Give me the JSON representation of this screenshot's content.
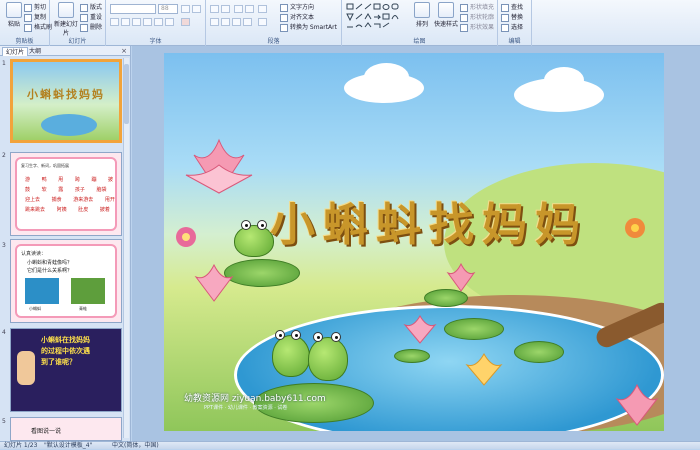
{
  "ribbon": {
    "groups": [
      {
        "title": "剪贴板",
        "buttons": [
          "粘贴",
          "剪切",
          "复制",
          "格式刷"
        ]
      },
      {
        "title": "幻灯片",
        "buttons": [
          "新建幻灯片",
          "版式",
          "重设",
          "删除"
        ]
      },
      {
        "title": "字体",
        "buttons": []
      },
      {
        "title": "段落",
        "buttons": [
          "文字方向",
          "对齐文本",
          "转换为 SmartArt"
        ]
      },
      {
        "title": "绘图",
        "buttons": [
          "排列",
          "快速样式",
          "形状填充",
          "形状轮廓",
          "形状效果"
        ]
      },
      {
        "title": "编辑",
        "buttons": [
          "查找",
          "替换",
          "选择"
        ]
      }
    ],
    "font_name": "",
    "font_size": "88"
  },
  "panel": {
    "tabs": [
      "幻灯片",
      "大纲"
    ],
    "slide_numbers": [
      "1",
      "2",
      "3",
      "4",
      "5"
    ],
    "thumb1_title": "小蝌蚪找妈妈",
    "thumb2_words": [
      "复习生字、新词，巩固拓展",
      "游",
      "鸭",
      "甩",
      "跨",
      "蹦",
      "披",
      "鼓",
      "软",
      "露",
      "孩子",
      "脑袋",
      "迎上去",
      "捕食",
      "游来游去",
      "甩开",
      "跳来跳去",
      "阿姨",
      "肚皮",
      "披着"
    ],
    "thumb3_lines": [
      "认真读读：",
      "小蝌蚪和青蛙像吗？",
      "它们是什么关系啊？",
      "小蝌蚪",
      "青蛙"
    ],
    "thumb4_lines": [
      "小蝌蚪在找妈妈",
      "的过程中依次遇",
      "到了谁呢？"
    ],
    "thumb5_title": "看图说一说"
  },
  "slide": {
    "title": "小蝌蚪找妈妈",
    "watermark": "幼教资源网 ziyuan.baby611.com",
    "watermark_sub": "PPT课件 · 幼儿课件 · 教案资源 · 试卷"
  },
  "status": {
    "slide_info": "幻灯片 1/23",
    "theme": "\"默认设计模板_4\"",
    "language": "中文(简体，中国)"
  }
}
